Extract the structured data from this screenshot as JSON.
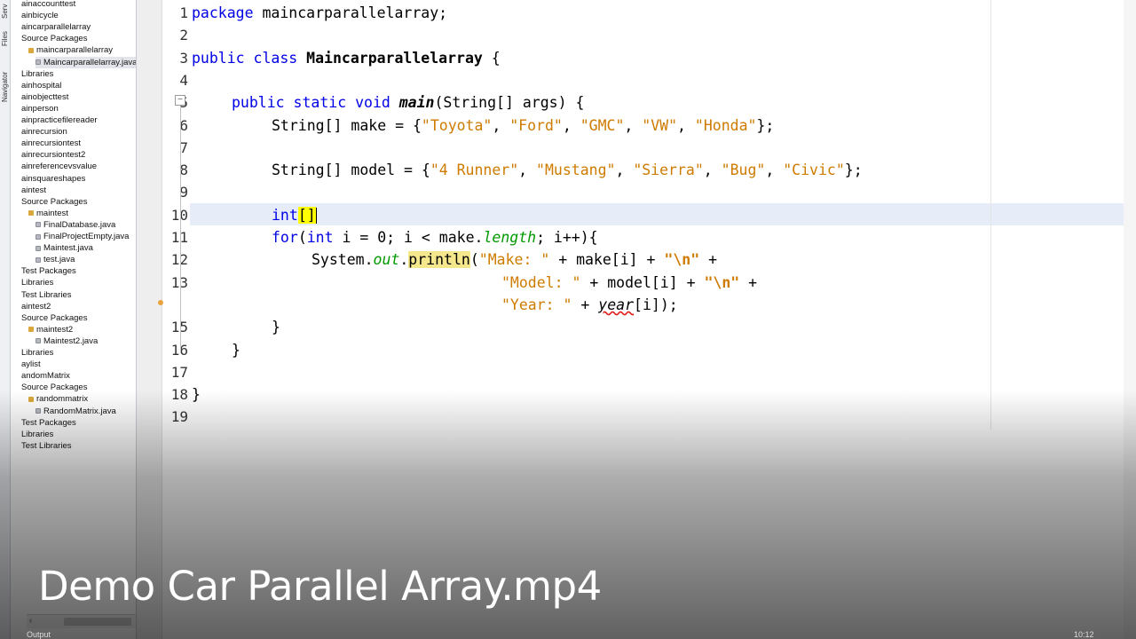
{
  "side_tabs": {
    "services": "Serv",
    "files": "Files",
    "navigator": "Navigator"
  },
  "project_tree": [
    {
      "label": "ainaccounttest",
      "type": "project"
    },
    {
      "label": "ainbicycle",
      "type": "project"
    },
    {
      "label": "aincarparallelarray",
      "type": "project"
    },
    {
      "label": "Source Packages",
      "type": "folder"
    },
    {
      "label": "maincarparallelarray",
      "type": "package"
    },
    {
      "label": "Maincarparallelarray.java",
      "type": "file",
      "selected": true
    },
    {
      "label": "Libraries",
      "type": "folder"
    },
    {
      "label": "ainhospital",
      "type": "project"
    },
    {
      "label": "ainobjecttest",
      "type": "project"
    },
    {
      "label": "ainperson",
      "type": "project"
    },
    {
      "label": "ainpracticefilereader",
      "type": "project"
    },
    {
      "label": "ainrecursion",
      "type": "project"
    },
    {
      "label": "ainrecursiontest",
      "type": "project"
    },
    {
      "label": "ainrecursiontest2",
      "type": "project"
    },
    {
      "label": "ainreferencevsvalue",
      "type": "project"
    },
    {
      "label": "ainsquareshapes",
      "type": "project"
    },
    {
      "label": "aintest",
      "type": "project"
    },
    {
      "label": "Source Packages",
      "type": "folder"
    },
    {
      "label": "maintest",
      "type": "package"
    },
    {
      "label": "FinalDatabase.java",
      "type": "file"
    },
    {
      "label": "FinalProjectEmpty.java",
      "type": "file"
    },
    {
      "label": "Maintest.java",
      "type": "file"
    },
    {
      "label": "test.java",
      "type": "file"
    },
    {
      "label": "Test Packages",
      "type": "folder"
    },
    {
      "label": "Libraries",
      "type": "folder"
    },
    {
      "label": "Test Libraries",
      "type": "folder"
    },
    {
      "label": "aintest2",
      "type": "project"
    },
    {
      "label": "Source Packages",
      "type": "folder"
    },
    {
      "label": "maintest2",
      "type": "package"
    },
    {
      "label": "Maintest2.java",
      "type": "file"
    },
    {
      "label": "Libraries",
      "type": "folder"
    },
    {
      "label": "aylist",
      "type": "project"
    },
    {
      "label": "andomMatrix",
      "type": "project"
    },
    {
      "label": "Source Packages",
      "type": "folder"
    },
    {
      "label": "randommatrix",
      "type": "package"
    },
    {
      "label": "RandomMatrix.java",
      "type": "file"
    },
    {
      "label": "Test Packages",
      "type": "folder"
    },
    {
      "label": "Libraries",
      "type": "folder"
    },
    {
      "label": "Test Libraries",
      "type": "folder"
    }
  ],
  "editor": {
    "line_numbers": [
      "1",
      "2",
      "3",
      "4",
      "5",
      "6",
      "7",
      "8",
      "9",
      "10",
      "11",
      "12",
      "13",
      "",
      "15",
      "16",
      "17",
      "18",
      "19"
    ],
    "code": {
      "l1_kw": "package",
      "l1_rest": " maincarparallelarray;",
      "l3_kw": "public class",
      "l3_cls": "Maincarparallelarray",
      "l3_rest": " {",
      "l5_kw": "public static void",
      "l5_mth": "main",
      "l5_rest": "(String[] args) {",
      "l6_a": "String[] make = {",
      "l6_s1": "\"Toyota\"",
      "l6_c1": ", ",
      "l6_s2": "\"Ford\"",
      "l6_c2": ", ",
      "l6_s3": "\"GMC\"",
      "l6_c3": ", ",
      "l6_s4": "\"VW\"",
      "l6_c4": ", ",
      "l6_s5": "\"Honda\"",
      "l6_end": "};",
      "l8_a": "String[] model = {",
      "l8_s1": "\"4 Runner\"",
      "l8_c1": ", ",
      "l8_s2": "\"Mustang\"",
      "l8_c2": ", ",
      "l8_s3": "\"Sierra\"",
      "l8_c3": ", ",
      "l8_s4": "\"Bug\"",
      "l8_c4": ", ",
      "l8_s5": "\"Civic\"",
      "l8_end": "};",
      "l10_kw": "int",
      "l10_br": "[]",
      "l11_kw1": "for",
      "l11_a": "(",
      "l11_kw2": "int",
      "l11_b": " i = 0; i < make.",
      "l11_fld": "length",
      "l11_c": "; i++){",
      "l12_a": "System.",
      "l12_fld": "out",
      "l12_b": ".",
      "l12_m": "println",
      "l12_c": "(",
      "l12_s1": "\"Make: \"",
      "l12_d": " + make[i] + ",
      "l12_esc": "\"\\n\"",
      "l12_e": " +",
      "l13_s1": "\"Model: \"",
      "l13_d": " + model[i] + ",
      "l13_esc": "\"\\n\"",
      "l13_e": " +",
      "l14_s1": "\"Year: \"",
      "l14_d": " + ",
      "l14_err": "year",
      "l14_e": "[i]);",
      "l15": "}",
      "l16": "}",
      "l18": "}"
    }
  },
  "caption": "Demo Car Parallel Array.mp4",
  "bottom": {
    "output_tab": "Output",
    "clock": "10:12"
  }
}
